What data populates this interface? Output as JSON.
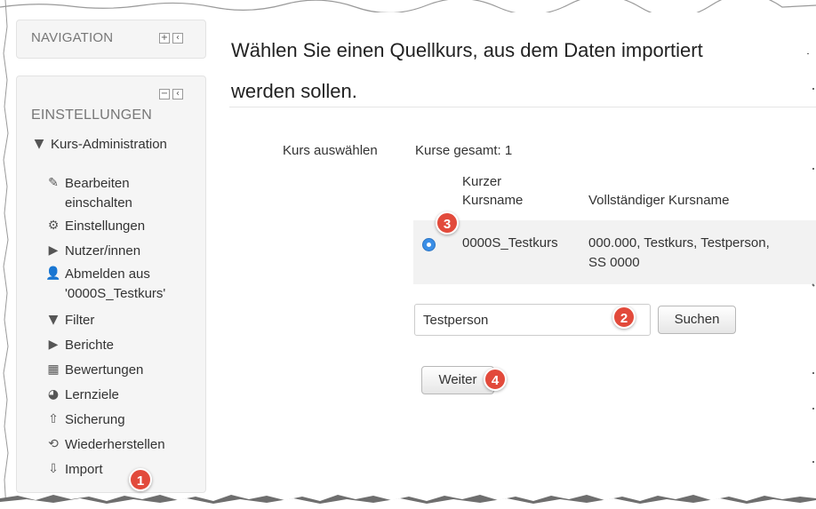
{
  "sidebar": {
    "navigation_title": "NAVIGATION",
    "settings_title": "EINSTELLUNGEN",
    "items": [
      {
        "label": "Kurs-Administration",
        "icon": "caret-down-icon"
      },
      {
        "label": "Bearbeiten einschalten",
        "icon": "pencil-icon"
      },
      {
        "label": "Einstellungen",
        "icon": "gear-icon"
      },
      {
        "label": "Nutzer/innen",
        "icon": "caret-right-icon"
      },
      {
        "label": "Abmelden aus '0000S_Testkurs'",
        "icon": "user-icon"
      },
      {
        "label": "Filter",
        "icon": "filter-icon"
      },
      {
        "label": "Berichte",
        "icon": "caret-right-icon"
      },
      {
        "label": "Bewertungen",
        "icon": "table-icon"
      },
      {
        "label": "Lernziele",
        "icon": "pie-icon"
      },
      {
        "label": "Sicherung",
        "icon": "upload-icon"
      },
      {
        "label": "Wiederherstellen",
        "icon": "restore-icon"
      },
      {
        "label": "Import",
        "icon": "download-icon"
      }
    ]
  },
  "main": {
    "title_line1": "Wählen Sie einen Quellkurs, aus dem Daten importiert",
    "title_line2": "werden sollen.",
    "select_label": "Kurs auswählen",
    "total_courses": "Kurse gesamt: 1",
    "col_short_line1": "Kurzer",
    "col_short_line2": "Kursname",
    "col_full": "Vollständiger Kursname",
    "row": {
      "short": "0000S_Testkurs",
      "full_line1": "000.000, Testkurs, Testperson,",
      "full_line2": "SS 0000"
    },
    "search_value": "Testperson",
    "search_button": "Suchen",
    "next_button": "Weiter"
  },
  "badges": {
    "b1": "1",
    "b2": "2",
    "b3": "3",
    "b4": "4"
  },
  "colors": {
    "badge": "#e24a3b",
    "radio": "#3a8ee6",
    "block_bg": "#f5f5f5"
  }
}
